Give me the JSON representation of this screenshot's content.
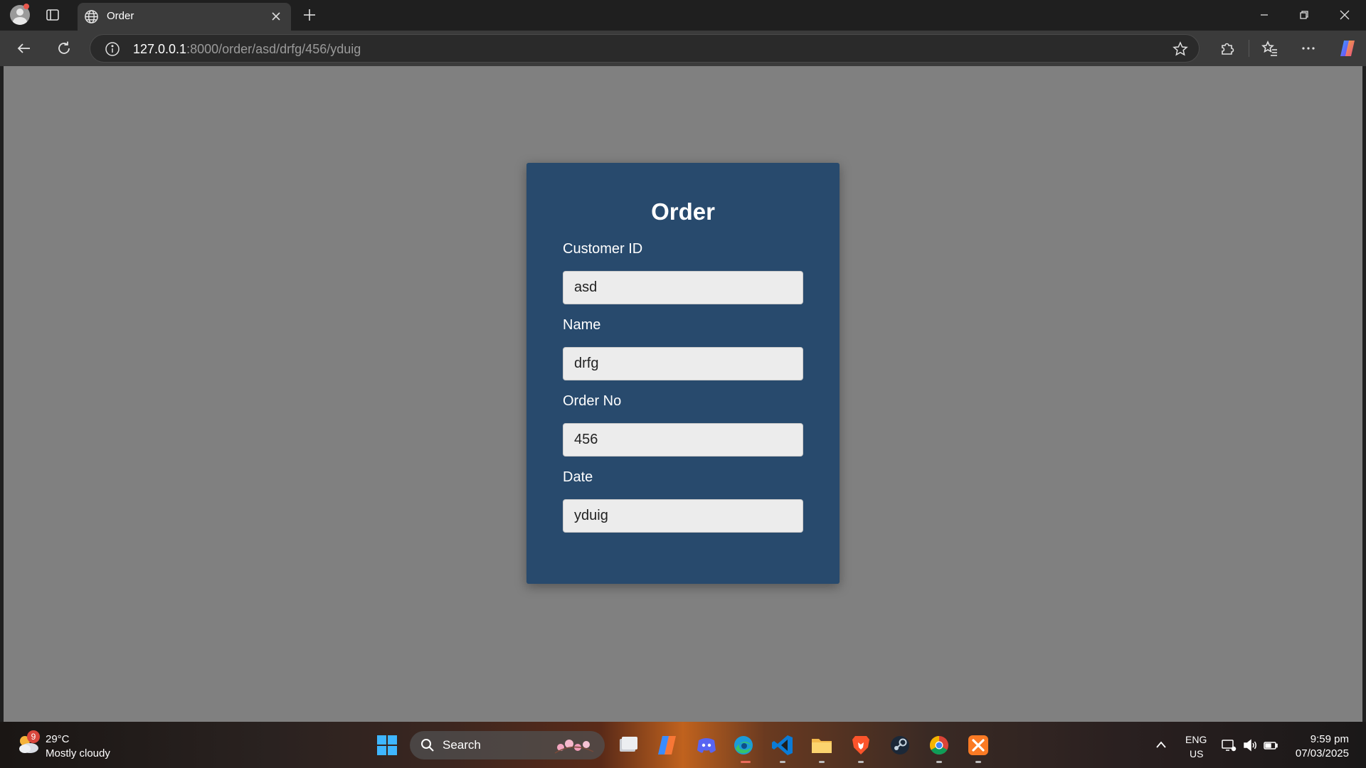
{
  "browser": {
    "tab": {
      "title": "Order"
    },
    "url": {
      "host": "127.0.0.1",
      "path": ":8000/order/asd/drfg/456/yduig"
    }
  },
  "page": {
    "title": "Order",
    "fields": [
      {
        "label": "Customer ID",
        "value": "asd"
      },
      {
        "label": "Name",
        "value": "drfg"
      },
      {
        "label": "Order No",
        "value": "456"
      },
      {
        "label": "Date",
        "value": "yduig"
      }
    ]
  },
  "taskbar": {
    "weather": {
      "badge": "9",
      "temperature": "29°C",
      "condition": "Mostly cloudy"
    },
    "search_label": "Search",
    "apps": [
      "file-explorer-icon",
      "copilot-icon",
      "discord-icon",
      "edge-icon",
      "vscode-icon",
      "folder-icon",
      "brave-icon",
      "steam-icon",
      "chrome-icon",
      "xampp-icon"
    ],
    "language": {
      "line1": "ENG",
      "line2": "US"
    },
    "clock": {
      "time": "9:59 pm",
      "date": "07/03/2025"
    }
  },
  "colors": {
    "card_background": "#284a6d",
    "viewport_background": "#808080",
    "input_background": "#ececec"
  }
}
